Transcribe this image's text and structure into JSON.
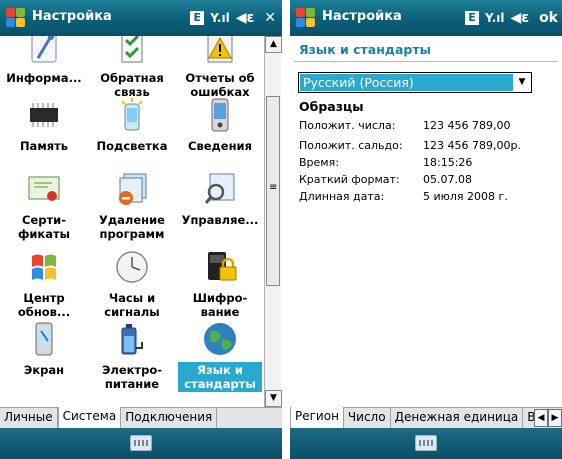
{
  "left": {
    "title": "Настройка",
    "status": {
      "network": "E",
      "signal": "Y.ıl",
      "volume": "◀ε",
      "close": "✕"
    },
    "grid": [
      {
        "label": "Информа...",
        "icon": "information-icon"
      },
      {
        "label": "Обратная связь",
        "icon": "feedback-icon"
      },
      {
        "label": "Отчеты об ошибках",
        "icon": "error-report-icon"
      },
      {
        "label": "Память",
        "icon": "memory-chip-icon"
      },
      {
        "label": "Подсветка",
        "icon": "backlight-icon"
      },
      {
        "label": "Сведения",
        "icon": "device-info-icon"
      },
      {
        "label": "Серти-фикаты",
        "icon": "certificate-icon"
      },
      {
        "label": "Удаление программ",
        "icon": "remove-programs-icon"
      },
      {
        "label": "Управляе...",
        "icon": "managed-programs-icon"
      },
      {
        "label": "Центр обнов...",
        "icon": "update-center-icon"
      },
      {
        "label": "Часы и сигналы",
        "icon": "clock-icon"
      },
      {
        "label": "Шифро-вание",
        "icon": "encryption-lock-icon"
      },
      {
        "label": "Экран",
        "icon": "screen-icon"
      },
      {
        "label": "Электро-питание",
        "icon": "power-battery-icon"
      },
      {
        "label": "Язык и стандарты",
        "icon": "globe-icon",
        "selected": true
      }
    ],
    "tabs": [
      {
        "label": "Личные"
      },
      {
        "label": "Система",
        "active": true
      },
      {
        "label": "Подключения"
      }
    ]
  },
  "right": {
    "title": "Настройка",
    "status": {
      "network": "E",
      "signal": "Y.ıl",
      "volume": "◀ε",
      "ok": "ok"
    },
    "heading": "Язык и стандарты",
    "locale": "Русский (Россия)",
    "samples_title": "Образцы",
    "samples": [
      {
        "key": "Положит. числа:",
        "value": "123 456 789,00"
      },
      {
        "key": "Положит. сальдо:",
        "value": "123 456 789,00р."
      },
      {
        "key": "Время:",
        "value": "18:15:26"
      },
      {
        "key": "Краткий формат:",
        "value": "05.07.08"
      },
      {
        "key": "Длинная дата:",
        "value": "5 июля 2008 г."
      }
    ],
    "tabs": [
      {
        "label": "Регион",
        "active": true
      },
      {
        "label": "Число"
      },
      {
        "label": "Денежная единица"
      },
      {
        "label": "Вр"
      }
    ]
  },
  "colors": {
    "titlebar": "#0c5f78",
    "accent": "#2aa9cf",
    "heading": "#1c7fa3"
  }
}
